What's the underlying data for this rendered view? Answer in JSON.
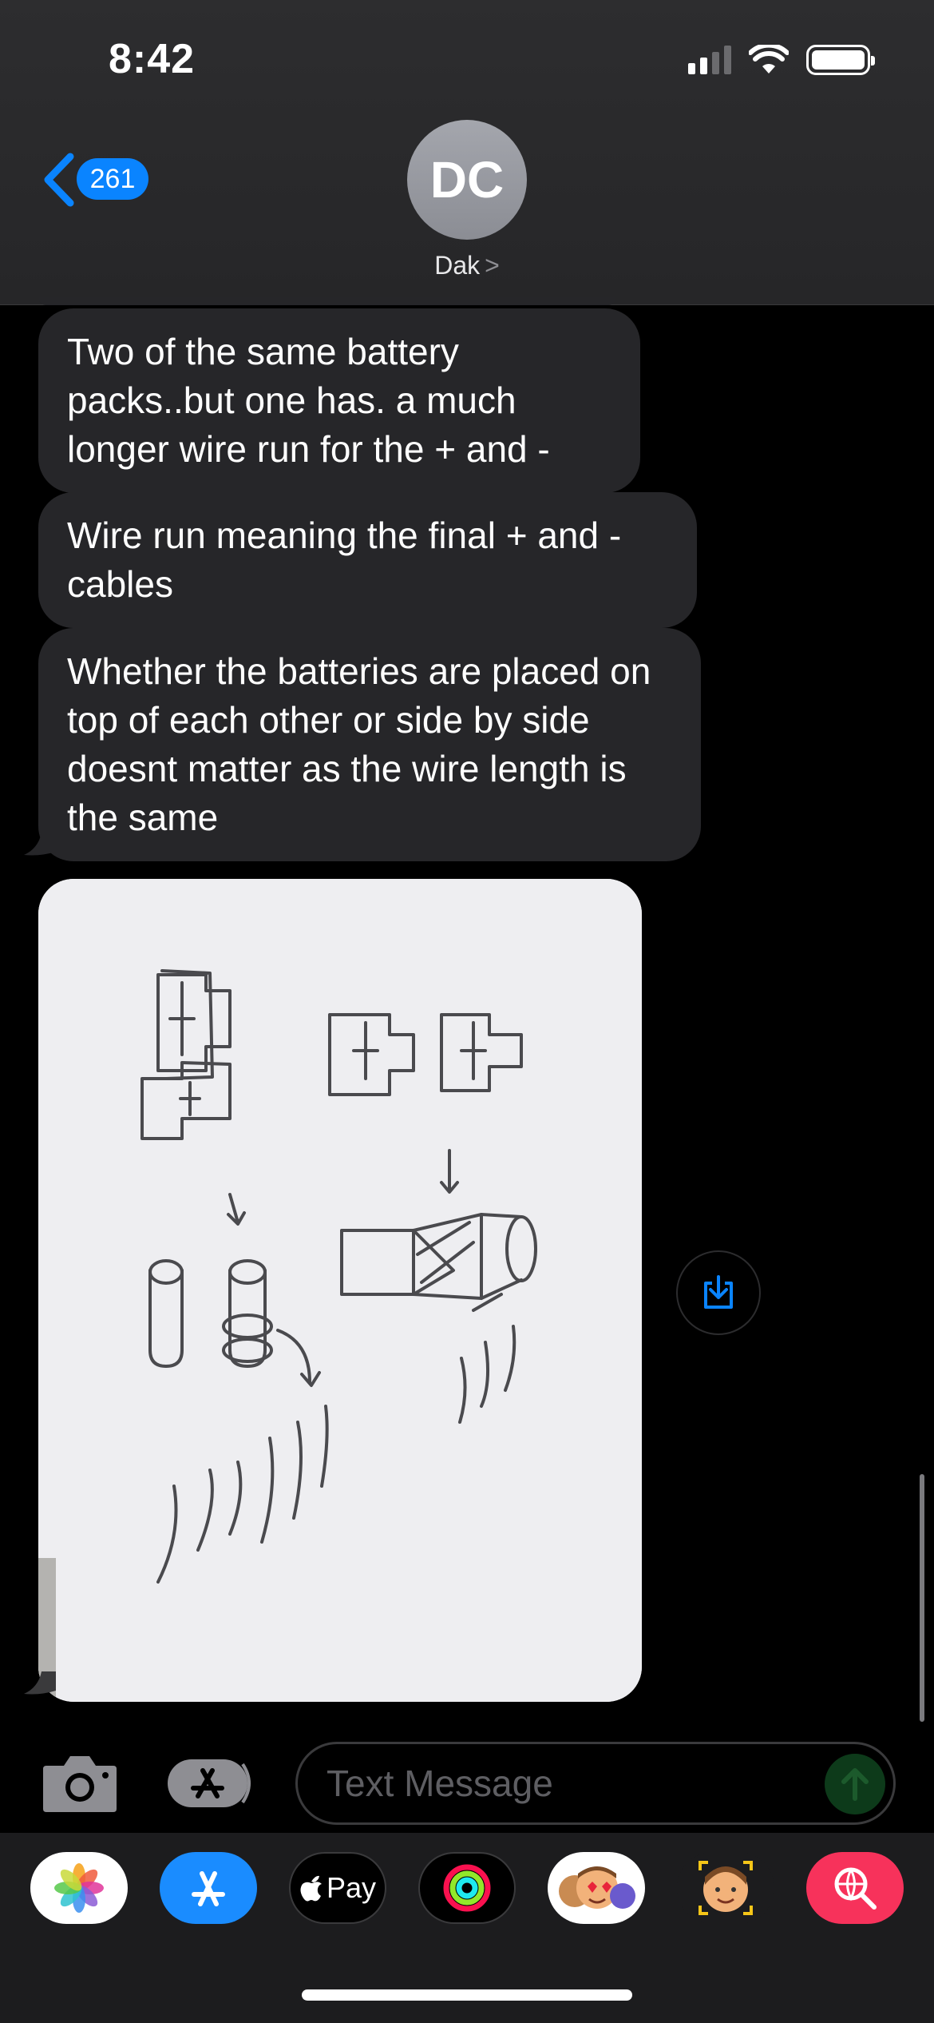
{
  "status_bar": {
    "time": "8:42"
  },
  "header": {
    "back_count": "261",
    "avatar_initials": "DC",
    "contact_name": "Dak",
    "contact_chevron": ">"
  },
  "messages": [
    {
      "text": "Two of the same battery packs..but one has. a much longer wire run for the + and -"
    },
    {
      "text": "Wire run meaning the final + and - cables"
    },
    {
      "text": "Whether the batteries are placed on top of each other or side by side doesnt matter as the wire length is the same"
    }
  ],
  "compose": {
    "placeholder": "Text Message"
  },
  "app_drawer": [
    {
      "icon": "photos-icon",
      "bg": "#ffffff"
    },
    {
      "icon": "app-store-icon",
      "bg": "#1a8cff"
    },
    {
      "icon": "apple-pay-icon",
      "bg": "#000000",
      "label": "Pay"
    },
    {
      "icon": "activity-icon",
      "bg": "#000000"
    },
    {
      "icon": "memoji-stickers-icon",
      "bg": "#ffffff"
    },
    {
      "icon": "memoji-icon",
      "bg": "#1c1c1e"
    },
    {
      "icon": "images-search-icon",
      "bg": "#f7325b"
    }
  ],
  "colors": {
    "accent": "#0a84ff",
    "bubble": "#262629",
    "send": "#0d3a1a"
  }
}
